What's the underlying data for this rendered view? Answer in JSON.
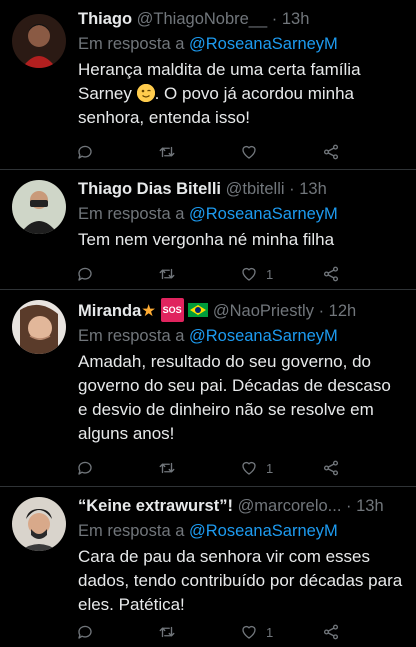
{
  "tweets": [
    {
      "name": "Thiago",
      "handle": "@ThiagoNobre__",
      "time": "13h",
      "reply_prefix": "Em resposta a",
      "reply_to": "@RoseanaSarneyM",
      "text_before": "Herança maldita de uma certa família Sarney",
      "emoji": "winking-face",
      "text_after": ". O povo já acordou minha senhora, entenda isso!",
      "likes": ""
    },
    {
      "name": "Thiago Dias Bitelli",
      "handle": "@tbitelli",
      "time": "13h",
      "reply_prefix": "Em resposta a",
      "reply_to": "@RoseanaSarneyM",
      "text": "Tem nem vergonha né minha filha",
      "likes": "1"
    },
    {
      "name": "Miranda",
      "name_badges": [
        "star-emoji",
        "sos-badge",
        "brazil-flag"
      ],
      "sos_label": "SOS",
      "handle": "@NaoPriestly",
      "time": "12h",
      "reply_prefix": "Em resposta a",
      "reply_to": "@RoseanaSarneyM",
      "text": "Amadah, resultado do seu governo, do governo do seu pai. Décadas de descaso e desvio de dinheiro não se resolve em alguns anos!",
      "likes": "1"
    },
    {
      "name": "“Keine extrawurst”!",
      "handle": "@marcorelo...",
      "time": "13h",
      "reply_prefix": "Em resposta a",
      "reply_to": "@RoseanaSarneyM",
      "text": "Cara de pau da senhora vir com esses dados, tendo contribuído por décadas para eles. Patética!",
      "likes": "1"
    }
  ],
  "colors": {
    "background": "#000000",
    "link": "#1d9bf0",
    "muted": "#71767b",
    "text": "#e7e9ea"
  }
}
